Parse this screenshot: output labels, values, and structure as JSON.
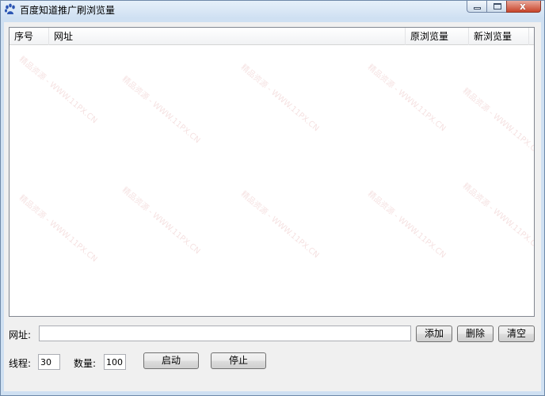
{
  "window": {
    "title": "百度知道推广刷浏览量",
    "close_glyph": "x"
  },
  "listview": {
    "columns": [
      "序号",
      "网址",
      "原浏览量",
      "新浏览量"
    ],
    "rows": []
  },
  "url_row": {
    "label": "网址:",
    "value": "",
    "add_label": "添加",
    "delete_label": "删除",
    "clear_label": "清空"
  },
  "controls": {
    "threads_label": "线程:",
    "threads_value": "30",
    "count_label": "数量:",
    "count_value": "100",
    "start_label": "启动",
    "stop_label": "停止"
  },
  "watermark_text": "精品资源 - WWW.11PX.CN"
}
